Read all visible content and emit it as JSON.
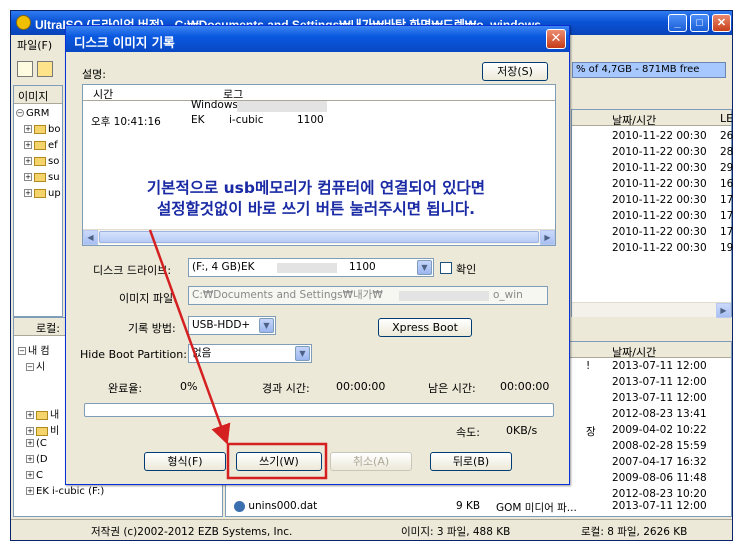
{
  "main_window": {
    "title": "UltraISO (드라이언 버전) - C:₩Documents and Settings₩내가₩바탕 화면₩드렌₩o_windows....",
    "menu": "파일(F)",
    "capacity": "% of 4,7GB - 871MB free",
    "top_pane_tab": "이미지",
    "top_tree": [
      "GRM",
      "bo",
      "ef",
      "so",
      "su",
      "up"
    ],
    "top_col_datetime": "날짜/시간",
    "top_col_l": "LE",
    "top_rows": [
      {
        "date": "2010-11-22 00:30",
        "v": "26"
      },
      {
        "date": "2010-11-22 00:30",
        "v": "28"
      },
      {
        "date": "2010-11-22 00:30",
        "v": "29"
      },
      {
        "date": "2010-11-22 00:30",
        "v": "16"
      },
      {
        "date": "2010-11-22 00:30",
        "v": "17"
      },
      {
        "date": "2010-11-22 00:30",
        "v": "17"
      },
      {
        "date": "2010-11-22 00:30",
        "v": "17"
      },
      {
        "date": "2010-11-22 00:30",
        "v": "19"
      }
    ],
    "bottom_pane_tab": "로컬:",
    "bottom_tree": [
      "내 컴",
      "시",
      "내",
      "비",
      "(C",
      "(D",
      "C",
      "EK i-cubic (F:)"
    ],
    "bottom_col_datetime": "날짜/시간",
    "bottom_rows": [
      {
        "flag": "!",
        "date": "2013-07-11 12:00"
      },
      {
        "flag": "",
        "date": "2013-07-11 12:00"
      },
      {
        "flag": "",
        "date": "2013-07-11 12:00"
      },
      {
        "flag": "",
        "date": "2012-08-23 13:41"
      },
      {
        "flag": "장",
        "date": "2009-04-02 10:22"
      },
      {
        "flag": "",
        "date": "2008-02-28 15:59"
      },
      {
        "flag": "",
        "date": "2007-04-17 16:32"
      },
      {
        "flag": "",
        "date": "2009-08-06 11:48"
      },
      {
        "flag": "",
        "date": "2012-08-23 10:20"
      }
    ],
    "bottom_file": {
      "name": "unins000.dat",
      "size": "9 KB",
      "type": "GOM 미디어 파...",
      "date": "2013-07-11 12:00"
    },
    "status_copyright": "저작권 (c)2002-2012 EZB Systems, Inc.",
    "status_image": "이미지: 3 파일, 488 KB",
    "status_local": "로컬: 8 파일, 2626 KB"
  },
  "dialog": {
    "title": "디스크 이미지 기록",
    "close_glyph": "✕",
    "desc_label": "설명:",
    "save_button": "저장(S)",
    "log_col_time": "시간",
    "log_col_log": "로그",
    "log_line1": "Windows",
    "log_time": "오후 10:41:16",
    "log_ek": "EK",
    "log_icubic": "i-cubic",
    "log_num": "1100",
    "drive_label": "디스크 드라이브:",
    "drive_value": "(F:, 4 GB)EK",
    "drive_value2": "1100",
    "verify_label": "확인",
    "image_file_label": "이미지 파일:",
    "image_file_value": "C:₩Documents and Settings₩내가₩",
    "image_file_tail": "o_win",
    "write_method_label": "기록 방법:",
    "write_method_value": "USB-HDD+",
    "xpress_boot_button": "Xpress Boot",
    "hide_boot_label": "Hide Boot Partition:",
    "hide_boot_value": "없음",
    "complete_label": "완료율:",
    "complete_value": "0%",
    "elapsed_label": "경과 시간:",
    "elapsed_value": "00:00:00",
    "remaining_label": "남은 시간:",
    "remaining_value": "00:00:00",
    "speed_label": "속도:",
    "speed_value": "0KB/s",
    "progress": 0,
    "format_button": "형식(F)",
    "write_button": "쓰기(W)",
    "cancel_button": "취소(A)",
    "back_button": "뒤로(B)"
  },
  "annotation": {
    "line1": "기본적으로 usb메모리가 컴퓨터에 연결되어 있다면",
    "line2": "설정할것없이 바로 쓰기 버튼 눌러주시면 됩니다.",
    "color": "#1a2aa5",
    "highlight_color": "#d42020"
  }
}
